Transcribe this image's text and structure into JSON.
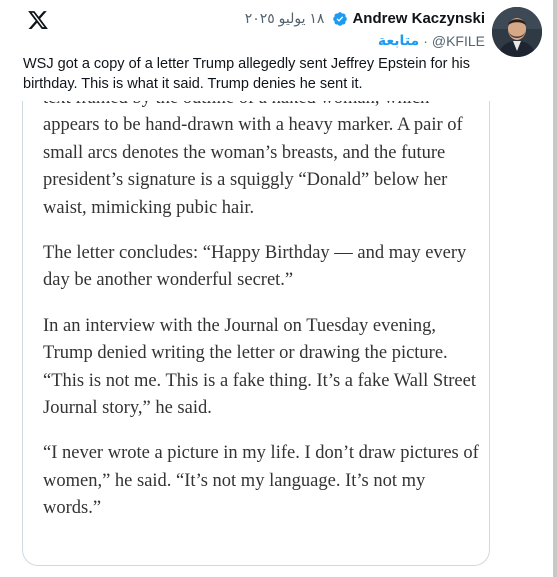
{
  "app": {
    "logo_icon": "x-logo-icon"
  },
  "tweet": {
    "author_name": "Andrew Kaczynski",
    "verified": true,
    "date": "١٨ يوليو ٢٠٢٥",
    "handle": "@KFILE",
    "separator": "·",
    "follow_label": "متابعة",
    "text": "WSJ got a copy of a letter Trump allegedly sent Jeffrey Epstein for his birthday. This is what it said. Trump denies he sent it."
  },
  "article_image": {
    "paragraphs": [
      "text framed by the outline of a naked woman, which appears to be hand-drawn with a heavy marker. A pair of small arcs denotes the woman’s breasts, and the future president’s signature is a squiggly “Donald” below her waist, mimicking pubic hair.",
      "The letter concludes: “Happy Birthday — and may every day be another wonderful secret.”",
      "In an interview with the Journal on Tuesday evening, Trump denied writing the letter or drawing the picture. “This is not me. This is a fake thing. It’s a fake Wall Street Journal story,” he said.",
      "“I never wrote a picture in my life. I don’t draw pictures of women,” he said. “It’s not my language. It’s not my words.”"
    ]
  },
  "colors": {
    "accent": "#1d9bf0",
    "text_primary": "#0f1419",
    "text_secondary": "#536471",
    "article_text": "#333333"
  }
}
